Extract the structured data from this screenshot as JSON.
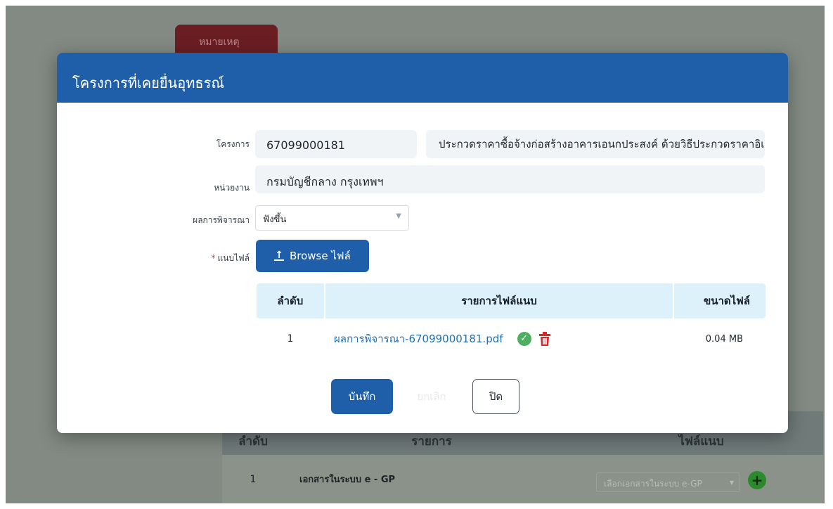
{
  "background": {
    "tab_label": "หมายเหตุ",
    "table": {
      "headers": [
        "ลำดับ",
        "รายการ",
        "ไฟล์แนบ"
      ],
      "rows": [
        {
          "index": "1",
          "item": "เอกสารในระบบ e - GP",
          "select_value": "เลือกเอกสารในระบบ e-GP",
          "add_icon": "plus-circle-icon"
        }
      ]
    }
  },
  "modal": {
    "title": "โครงการที่เคยยื่นอุทธรณ์",
    "fields": {
      "project_label": "โครงการ",
      "project_number": "67099000181",
      "project_description": "ประกวดราคาซื้อจ้างก่อสร้างอาคารเอนกประสงค์ ด้วยวิธีประกวดราคาอิเล็กทรอนิกส์ (e-bidding)",
      "agency_label": "หน่วยงาน",
      "agency_value": "กรมบัญชีกลาง กรุงเทพฯ",
      "result_label": "ผลการพิจารณา",
      "result_value": "ฟังขึ้น",
      "attach_label": "แนบไฟล์",
      "required_mark": "*"
    },
    "browse_button": "Browse ไฟล์",
    "file_table": {
      "headers": {
        "index": "ลำดับ",
        "name": "รายการไฟล์แนบ",
        "size": "ขนาดไฟล์"
      },
      "rows": [
        {
          "index": "1",
          "name": "ผลการพิจารณา-67099000181.pdf",
          "size": "0.04 MB"
        }
      ]
    },
    "buttons": {
      "save": "บันทึก",
      "cancel": "ยกเลิก",
      "close": "ปิด"
    }
  },
  "colors": {
    "primary": "#1f5ea8",
    "link": "#2170b5",
    "success": "#4caf62",
    "danger": "#d62a2a",
    "table_header": "#ddf1fb"
  }
}
